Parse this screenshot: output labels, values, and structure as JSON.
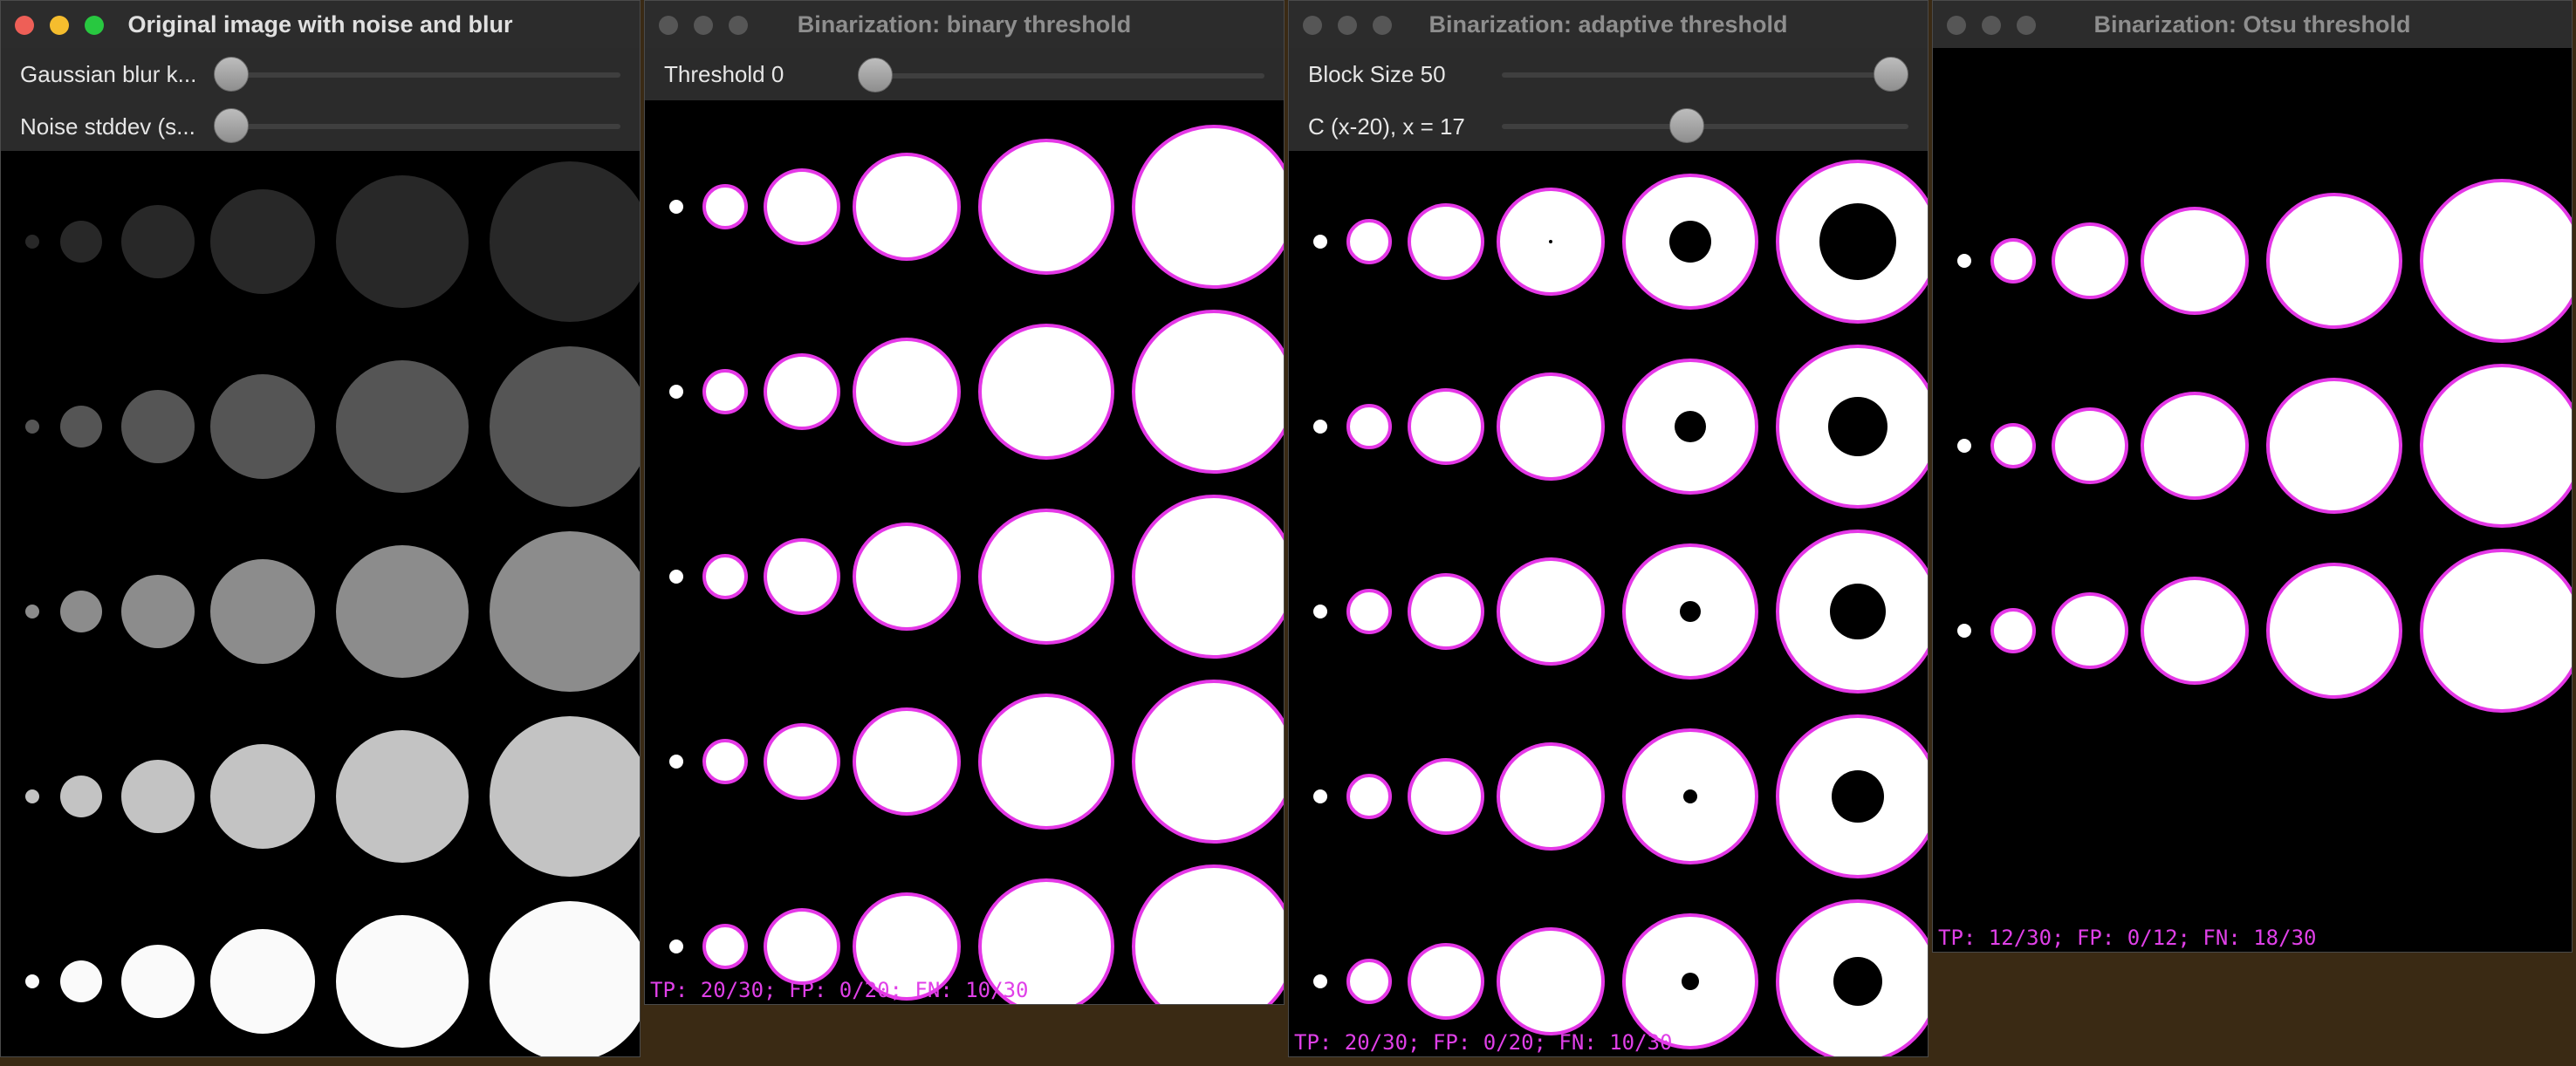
{
  "colors": {
    "outline": "#e438e6",
    "stats_text": "#e040e8",
    "title_active": "#e0e0e0",
    "title_inactive": "#8e8e8e",
    "traffic_close": "#ee5f57",
    "traffic_minimize": "#f5bd2e",
    "traffic_zoom": "#28c840"
  },
  "windows": [
    {
      "title": "Original image with noise and blur",
      "controls": [
        {
          "label": "Gaussian blur k...",
          "fraction": 0.0
        },
        {
          "label": "Noise stddev (s...",
          "fraction": 0.0
        }
      ],
      "gray_levels": [
        40,
        85,
        140,
        195,
        250
      ]
    },
    {
      "title": "Binarization: binary threshold",
      "controls": [
        {
          "label": "Threshold 0",
          "fraction": 0.0
        }
      ],
      "stats": "TP: 20/30; FP: 0/20; FN: 10/30"
    },
    {
      "title": "Binarization: adaptive threshold",
      "controls": [
        {
          "label": "Block Size 50",
          "fraction": 1.0
        },
        {
          "label": "C (x-20), x =  17",
          "fraction": 0.45
        }
      ],
      "stats": "TP: 20/30; FP: 0/20; FN: 10/30"
    },
    {
      "title": "Binarization: Otsu threshold",
      "controls": [],
      "stats": "TP: 12/30; FP: 0/12; FN: 18/30"
    }
  ]
}
